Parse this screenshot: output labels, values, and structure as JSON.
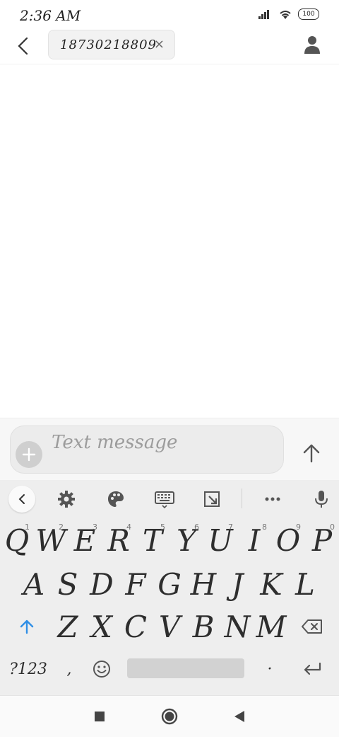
{
  "status_bar": {
    "time": "2:36 AM",
    "battery": "100"
  },
  "header": {
    "recipient": "18730218809",
    "remove_glyph": "×"
  },
  "compose": {
    "placeholder": "Text message"
  },
  "keyboard": {
    "row1": [
      {
        "label": "Q",
        "hint": "1"
      },
      {
        "label": "W",
        "hint": "2"
      },
      {
        "label": "E",
        "hint": "3"
      },
      {
        "label": "R",
        "hint": "4"
      },
      {
        "label": "T",
        "hint": "5"
      },
      {
        "label": "Y",
        "hint": "6"
      },
      {
        "label": "U",
        "hint": "7"
      },
      {
        "label": "I",
        "hint": "8"
      },
      {
        "label": "O",
        "hint": "9"
      },
      {
        "label": "P",
        "hint": "0"
      }
    ],
    "row2": [
      "A",
      "S",
      "D",
      "F",
      "G",
      "H",
      "J",
      "K",
      "L"
    ],
    "row3": [
      "Z",
      "X",
      "C",
      "V",
      "B",
      "N",
      "M"
    ],
    "symbols_key": "?123",
    "comma_key": ",",
    "period_key": "·"
  },
  "colors": {
    "accent": "#2f8fe6",
    "keyboard_bg": "#eeeeee"
  }
}
